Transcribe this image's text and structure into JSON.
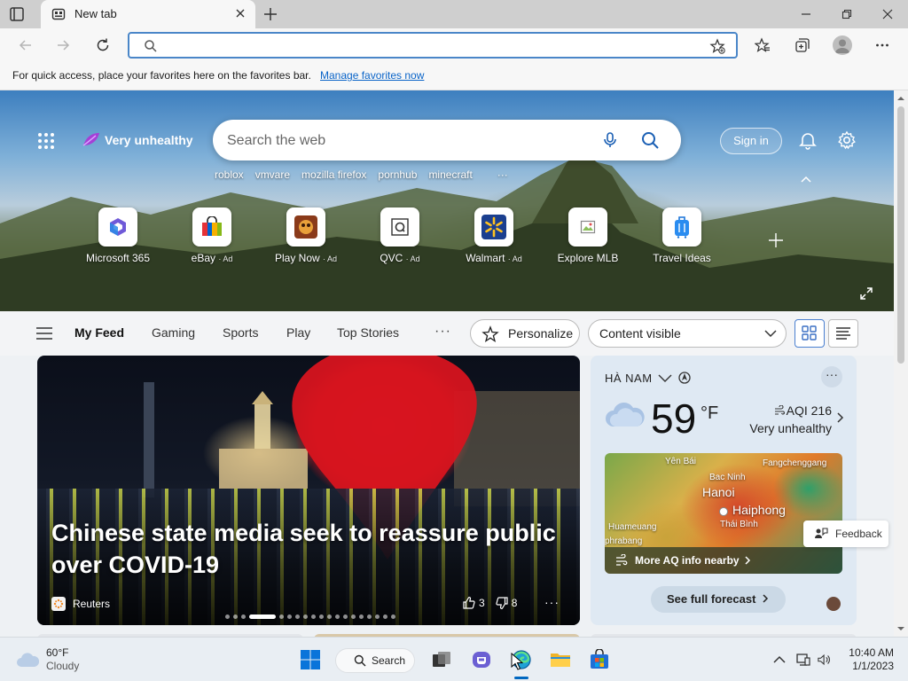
{
  "browser": {
    "tab_title": "New tab",
    "address_value": "",
    "favbar_message": "For quick access, place your favorites here on the favorites bar.",
    "favbar_link": "Manage favorites now"
  },
  "hero": {
    "brand": "Very unhealthy",
    "search_placeholder": "Search the web",
    "trending": [
      "roblox",
      "vmvare",
      "mozilla firefox",
      "pornhub",
      "minecraft"
    ],
    "trending_more": "···",
    "signin": "Sign in",
    "quick_links": [
      {
        "label": "Microsoft 365",
        "ad": ""
      },
      {
        "label": "eBay",
        "ad": "· Ad"
      },
      {
        "label": "Play Now",
        "ad": "· Ad"
      },
      {
        "label": "QVC",
        "ad": "· Ad"
      },
      {
        "label": "Walmart",
        "ad": "· Ad"
      },
      {
        "label": "Explore MLB",
        "ad": ""
      },
      {
        "label": "Travel Ideas",
        "ad": ""
      }
    ]
  },
  "feed": {
    "tabs": [
      "My Feed",
      "Gaming",
      "Sports",
      "Play",
      "Top Stories"
    ],
    "more": "···",
    "personalize": "Personalize",
    "content_visible": "Content visible"
  },
  "article": {
    "title": "Chinese state media seek to reassure public over COVID-19",
    "source": "Reuters",
    "likes": "3",
    "dislikes": "8",
    "more": "···",
    "slide_count": 19,
    "slide_active": 3
  },
  "weather": {
    "location": "HÀ NAM",
    "temp": "59",
    "unit": "°F",
    "aqi": "AQI 216",
    "aqi_status": "Very unhealthy",
    "map_labels": {
      "yen_bai": "Yên Bái",
      "bac_ninh": "Bac Ninh",
      "fangcheng": "Fangchenggang",
      "hanoi": "Hanoi",
      "haiphong": "Haiphong",
      "thai_binh": "Thái Bình",
      "huameuang": "Huameuang",
      "phrabang": "phrabang"
    },
    "map_footer": "More AQ info nearby",
    "forecast": "See full forecast",
    "more": "···"
  },
  "feedback": "Feedback",
  "taskbar": {
    "weather_temp": "60°F",
    "weather_cond": "Cloudy",
    "search": "Search",
    "time": "10:40 AM",
    "date": "1/1/2023"
  },
  "colors": {
    "accent": "#0067c0",
    "omnibox_border": "#4a86c8",
    "weather_card": "#dfe9f3"
  }
}
